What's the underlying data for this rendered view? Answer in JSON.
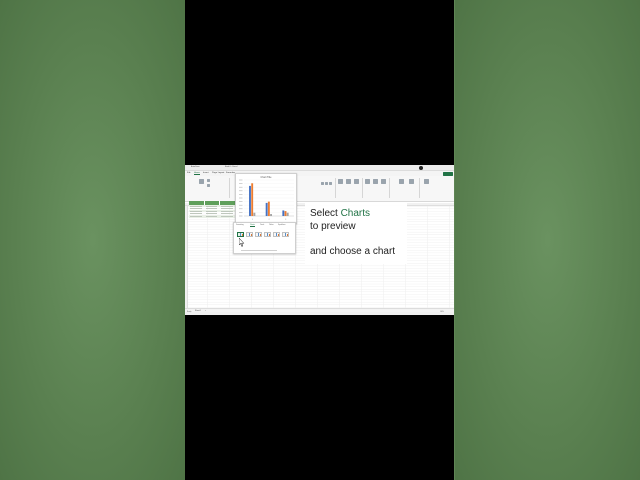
{
  "window": {
    "app_name": "AutoSave",
    "doc_title": "Book1 - Excel",
    "share_label": "Share"
  },
  "ribbon_tabs": [
    "File",
    "Home",
    "Insert",
    "Page Layout",
    "Formulas",
    "Data",
    "Review",
    "View",
    "Help"
  ],
  "chart_preview": {
    "title": "Chart Title"
  },
  "quick_analysis": {
    "tabs": [
      "Formatting",
      "Charts",
      "Totals",
      "Tables",
      "Sparklines"
    ],
    "selected_tab": "Charts",
    "options": [
      "Clustered...",
      "Stacked...",
      "Clustered...",
      "Stacked...",
      "Clustered...",
      "More..."
    ]
  },
  "sheet_tabs": [
    "Sheet1"
  ],
  "status_bar": {
    "ready": "Ready",
    "zoom": "100%"
  },
  "caption": {
    "line1_prefix": "Select ",
    "line1_highlight": "Charts",
    "line2": "to preview",
    "line3": "and choose a chart"
  },
  "colors": {
    "accent": "#217346",
    "side_background": "#5f8555",
    "series_blue": "#4472c4",
    "series_orange": "#ed7d31",
    "series_gray": "#a5a5a5"
  },
  "chart_data": {
    "type": "bar",
    "title": "Chart Title",
    "categories": [
      "1",
      "2",
      "3"
    ],
    "series": [
      {
        "values": [
          92,
          40,
          17
        ]
      },
      {
        "values": [
          100,
          44,
          15
        ]
      },
      {
        "values": [
          10,
          6,
          10
        ]
      }
    ],
    "ylim": [
      0,
      110
    ]
  }
}
